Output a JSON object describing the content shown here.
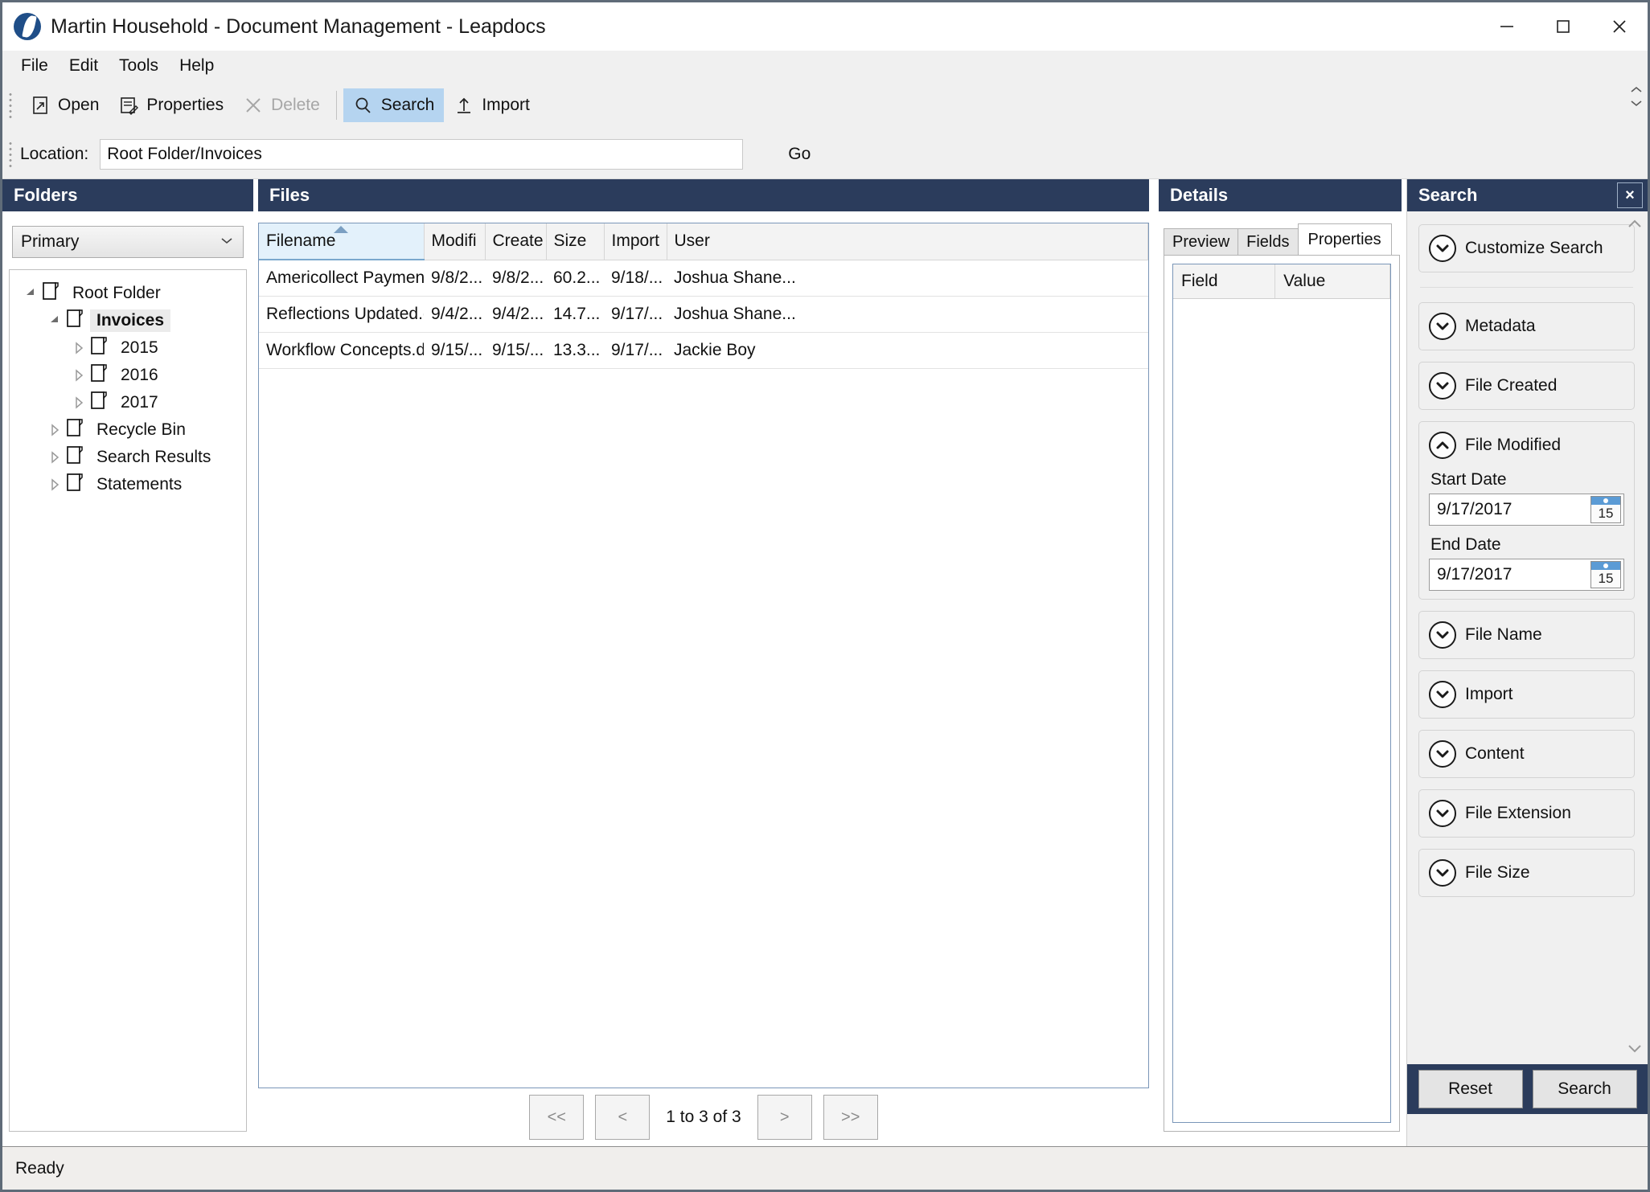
{
  "window": {
    "title": "Martin Household - Document Management - Leapdocs",
    "minimize_label": "Minimize",
    "maximize_label": "Maximize",
    "close_label": "Close"
  },
  "menu": {
    "items": [
      {
        "label": "File"
      },
      {
        "label": "Edit"
      },
      {
        "label": "Tools"
      },
      {
        "label": "Help"
      }
    ]
  },
  "toolbar": {
    "buttons": [
      {
        "label": "Open",
        "icon": "open-icon",
        "state": "normal"
      },
      {
        "label": "Properties",
        "icon": "properties-icon",
        "state": "normal"
      },
      {
        "label": "Delete",
        "icon": "delete-icon",
        "state": "disabled"
      },
      {
        "label": "Search",
        "icon": "search-icon",
        "state": "active"
      },
      {
        "label": "Import",
        "icon": "import-icon",
        "state": "normal"
      }
    ]
  },
  "location": {
    "label": "Location:",
    "value": "Root Folder/Invoices",
    "placeholder": "",
    "go_label": "Go"
  },
  "folders": {
    "header": "Folders",
    "combo_value": "Primary",
    "tree": [
      {
        "label": "Root Folder",
        "depth": 0,
        "twisty": "expanded",
        "selected": false
      },
      {
        "label": "Invoices",
        "depth": 1,
        "twisty": "expanded",
        "selected": true
      },
      {
        "label": "2015",
        "depth": 2,
        "twisty": "collapsed",
        "selected": false
      },
      {
        "label": "2016",
        "depth": 2,
        "twisty": "collapsed",
        "selected": false
      },
      {
        "label": "2017",
        "depth": 2,
        "twisty": "collapsed",
        "selected": false
      },
      {
        "label": "Recycle Bin",
        "depth": 1,
        "twisty": "collapsed",
        "selected": false
      },
      {
        "label": "Search Results",
        "depth": 1,
        "twisty": "collapsed",
        "selected": false
      },
      {
        "label": "Statements",
        "depth": 1,
        "twisty": "collapsed",
        "selected": false
      }
    ]
  },
  "files": {
    "header": "Files",
    "columns": [
      {
        "label": "Filename",
        "sorted": true,
        "sort_dir": "asc"
      },
      {
        "label": "Modifi",
        "sorted": false
      },
      {
        "label": "Create",
        "sorted": false
      },
      {
        "label": "Size",
        "sorted": false
      },
      {
        "label": "Import",
        "sorted": false
      },
      {
        "label": "User",
        "sorted": false
      }
    ],
    "rows": [
      {
        "filename": "Americollect Payment...",
        "modified": "9/8/2...",
        "created": "9/8/2...",
        "size": "60.2...",
        "imported": "9/18/...",
        "user": "Joshua Shane..."
      },
      {
        "filename": "Reflections Updated.d...",
        "modified": "9/4/2...",
        "created": "9/4/2...",
        "size": "14.7...",
        "imported": "9/17/...",
        "user": "Joshua Shane..."
      },
      {
        "filename": "Workflow Concepts.d...",
        "modified": "9/15/...",
        "created": "9/15/...",
        "size": "13.3...",
        "imported": "9/17/...",
        "user": "Jackie Boy"
      }
    ],
    "pager": {
      "first_label": "<<",
      "prev_label": "<",
      "status": "1 to 3 of 3",
      "next_label": ">",
      "last_label": ">>"
    }
  },
  "details": {
    "header": "Details",
    "tabs": [
      {
        "label": "Preview",
        "active": false
      },
      {
        "label": "Fields",
        "active": false
      },
      {
        "label": "Properties",
        "active": true
      }
    ],
    "properties_table": {
      "columns": [
        "Field",
        "Value"
      ],
      "rows": []
    }
  },
  "search": {
    "header": "Search",
    "close_label": "×",
    "sections": [
      {
        "label": "Customize Search",
        "expanded": false
      },
      {
        "label": "Metadata",
        "expanded": false
      },
      {
        "label": "File Created",
        "expanded": false
      },
      {
        "label": "File Modified",
        "expanded": true
      },
      {
        "label": "File Name",
        "expanded": false
      },
      {
        "label": "Import",
        "expanded": false
      },
      {
        "label": "Content",
        "expanded": false
      },
      {
        "label": "File Extension",
        "expanded": false
      },
      {
        "label": "File Size",
        "expanded": false
      }
    ],
    "file_modified": {
      "start_label": "Start Date",
      "start_value": "9/17/2017",
      "end_label": "End Date",
      "end_value": "9/17/2017",
      "calendar_day": "15"
    },
    "reset_label": "Reset",
    "search_label": "Search"
  },
  "status": {
    "text": "Ready"
  },
  "colors": {
    "panel_header": "#2b3c5c",
    "toolbar_active": "#b5d4f0",
    "chrome": "#f0f0f0",
    "logo": "#1f4e88"
  }
}
